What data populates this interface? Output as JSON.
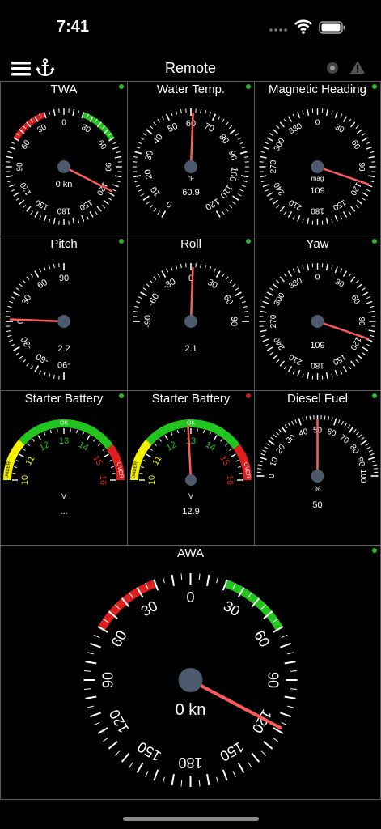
{
  "status_bar": {
    "time": "7:41"
  },
  "nav": {
    "title": "Remote",
    "menu_icon": "hamburger-menu-icon",
    "anchor_icon": "anchor-icon",
    "dot_icon": "record-dot-icon",
    "warn_icon": "warning-icon"
  },
  "colors": {
    "needle": "#ff5a5a",
    "hub": "#4d5a6e",
    "red_zone": "#e01e1e",
    "green_zone": "#22c41e",
    "yellow_zone": "#f5f000",
    "active_dot": "#2bb52b",
    "inactive_dot": "#c42020"
  },
  "gauges": [
    {
      "id": "twa",
      "title": "TWA",
      "type": "wind",
      "unit": "",
      "readout": "0 kn",
      "needle_angle": 117,
      "status": "active",
      "labels": [
        "0",
        "30",
        "60",
        "90",
        "120",
        "150",
        "180",
        "150",
        "120",
        "90",
        "60",
        "30"
      ]
    },
    {
      "id": "water_temp",
      "title": "Water Temp.",
      "type": "range",
      "unit": "°F",
      "readout": "60.9",
      "value": 60.9,
      "min": 0,
      "max": 120,
      "status": "active",
      "labels": [
        "0",
        "10",
        "20",
        "30",
        "40",
        "50",
        "60",
        "70",
        "80",
        "90",
        "100",
        "110",
        "120"
      ]
    },
    {
      "id": "mag_heading",
      "title": "Magnetic Heading",
      "type": "compass",
      "unit": "mag",
      "readout": "109",
      "value": 109,
      "status": "active",
      "labels": [
        "0",
        "30",
        "60",
        "90",
        "120",
        "150",
        "180",
        "210",
        "240",
        "270",
        "300",
        "330"
      ]
    },
    {
      "id": "pitch",
      "title": "Pitch",
      "type": "pitch",
      "unit": "",
      "readout": "2.2",
      "value": 2.2,
      "status": "active",
      "labels": [
        "90",
        "60",
        "30",
        "0",
        "-30",
        "-60",
        "-90"
      ]
    },
    {
      "id": "roll",
      "title": "Roll",
      "type": "roll",
      "unit": "",
      "readout": "2.1",
      "value": 2.1,
      "status": "active",
      "labels": [
        "-90",
        "-60",
        "-30",
        "0",
        "30",
        "60",
        "90"
      ]
    },
    {
      "id": "yaw",
      "title": "Yaw",
      "type": "compass",
      "unit": "",
      "readout": "109",
      "value": 109,
      "status": "active",
      "labels": [
        "0",
        "30",
        "60",
        "90",
        "120",
        "150",
        "180",
        "210",
        "240",
        "270",
        "300",
        "330"
      ]
    },
    {
      "id": "starter_battery_1",
      "title": "Starter Battery",
      "type": "battery",
      "unit": "V",
      "readout": "...",
      "value": null,
      "min": 10,
      "max": 16,
      "status": "active",
      "labels": [
        "10",
        "11",
        "12",
        "13",
        "14",
        "15",
        "16"
      ],
      "ok_label": "OK",
      "over_label": "OVER",
      "under_label": "UNDER"
    },
    {
      "id": "starter_battery_2",
      "title": "Starter Battery",
      "type": "battery",
      "unit": "V",
      "readout": "12.9",
      "value": 12.9,
      "min": 10,
      "max": 16,
      "status": "inactive",
      "labels": [
        "10",
        "11",
        "12",
        "13",
        "14",
        "15",
        "16"
      ],
      "ok_label": "OK",
      "over_label": "OVER",
      "under_label": "UNDER"
    },
    {
      "id": "diesel_fuel",
      "title": "Diesel Fuel",
      "type": "fuel",
      "unit": "%",
      "readout": "50",
      "value": 50,
      "min": 0,
      "max": 100,
      "status": "active",
      "labels": [
        "0",
        "10",
        "20",
        "30",
        "40",
        "50",
        "60",
        "70",
        "80",
        "90",
        "100"
      ]
    },
    {
      "id": "awa",
      "title": "AWA",
      "type": "wind",
      "unit": "",
      "readout": "0 kn",
      "needle_angle": 118,
      "status": "active",
      "labels": [
        "0",
        "30",
        "60",
        "90",
        "120",
        "150",
        "180",
        "150",
        "120",
        "90",
        "60",
        "30"
      ]
    }
  ]
}
